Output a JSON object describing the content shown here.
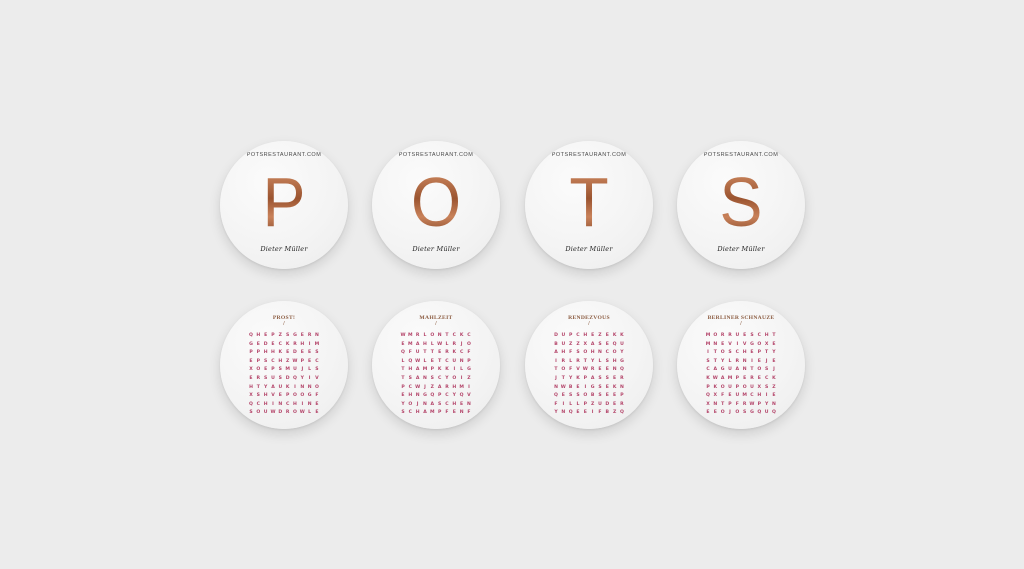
{
  "top_coasters": [
    {
      "url": "POTSRESTAURANT.COM",
      "letter": "P",
      "signature": "Dieter Müller"
    },
    {
      "url": "POTSRESTAURANT.COM",
      "letter": "O",
      "signature": "Dieter Müller"
    },
    {
      "url": "POTSRESTAURANT.COM",
      "letter": "T",
      "signature": "Dieter Müller"
    },
    {
      "url": "POTSRESTAURANT.COM",
      "letter": "S",
      "signature": "Dieter Müller"
    }
  ],
  "puzzles": [
    {
      "title": "PROST!",
      "tick": "/",
      "rows": [
        "QHEPZSGERN",
        "GEDECKRHIM",
        "PPHHKEDEES",
        "EPSCHZWPEC",
        "XOEPSMUJLS",
        "ERSUSDQYIV",
        "HTYAUKINNO",
        "XSHVEPOOGF",
        "QCHINCHINE",
        "SOUWDROWLE"
      ]
    },
    {
      "title": "MAHLZEIT",
      "tick": "/",
      "rows": [
        "WMRLONTCKC",
        "EMAHLWLRJO",
        "QFUTTERKCF",
        "LQWLETCUNP",
        "THAMPKKILG",
        "TSANSCYOIZ",
        "PCWJZARHMI",
        "EHNGQPCYQV",
        "YOJNASCHEN",
        "SCHAMPFENF"
      ]
    },
    {
      "title": "RENDEZVOUS",
      "tick": "/",
      "rows": [
        "DUPCHEZEKK",
        "BUZZXASEQU",
        "AHFSOHNCOY",
        "IRLRTYLSHG",
        "TOFVWREENQ",
        "JTYKPASSER",
        "NWBEIGSEKN",
        "QESSOBSEEP",
        "FILLPZUDER",
        "YNQEEIFBZQ"
      ]
    },
    {
      "title": "BERLINER SCHNAUZE",
      "tick": "/",
      "rows": [
        "MORRUESCHT",
        "MNEVIVGOXE",
        "ITOSCHEPTY",
        "STYLRNIEJE",
        "CAGUANTOSJ",
        "KWAMPERECK",
        "PKOUPOUXSZ",
        "QXFEUMCHIE",
        "XNTPFRWPYN",
        "EEOJOSGQUQ"
      ]
    }
  ]
}
